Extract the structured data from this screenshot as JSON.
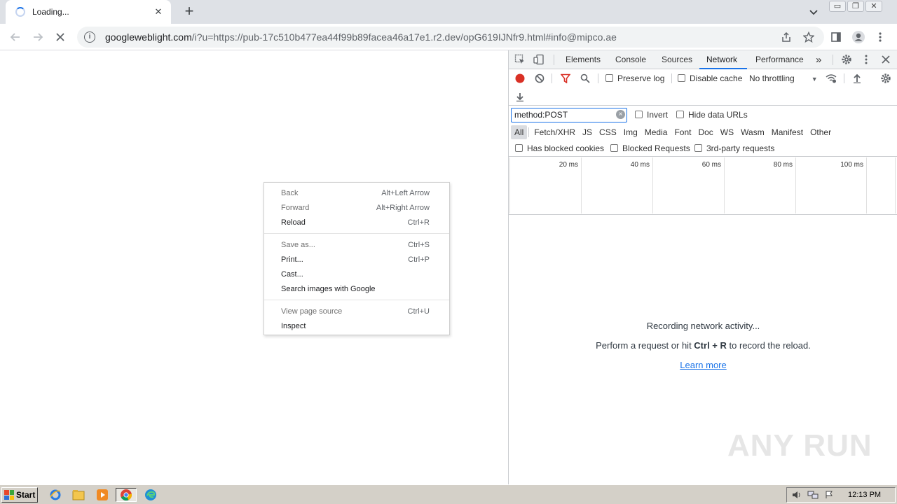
{
  "tab": {
    "title": "Loading...",
    "close": "✕"
  },
  "newtab": "+",
  "window_controls": {
    "minimize": "▭",
    "restore": "❐",
    "close": "✕"
  },
  "omnibox": {
    "host": "googleweblight.com",
    "rest": "/i?u=https://pub-17c510b477ea44f99b89facea46a17e1.r2.dev/opG619IJNfr9.html#info@mipco.ae"
  },
  "context_menu": {
    "items": [
      {
        "label": "Back",
        "shortcut": "Alt+Left Arrow",
        "disabled": true
      },
      {
        "label": "Forward",
        "shortcut": "Alt+Right Arrow",
        "disabled": true
      },
      {
        "label": "Reload",
        "shortcut": "Ctrl+R",
        "disabled": false
      },
      {
        "label": "Save as...",
        "shortcut": "Ctrl+S",
        "disabled": true
      },
      {
        "label": "Print...",
        "shortcut": "Ctrl+P",
        "disabled": false
      },
      {
        "label": "Cast...",
        "shortcut": "",
        "disabled": false
      },
      {
        "label": "Search images with Google",
        "shortcut": "",
        "disabled": false
      },
      {
        "label": "View page source",
        "shortcut": "Ctrl+U",
        "disabled": true
      },
      {
        "label": "Inspect",
        "shortcut": "",
        "disabled": false
      }
    ]
  },
  "devtools": {
    "tabs": [
      "Elements",
      "Console",
      "Sources",
      "Network",
      "Performance"
    ],
    "active_tab": "Network",
    "more_tabs": "»",
    "toolbar": {
      "preserve_log": "Preserve log",
      "disable_cache": "Disable cache",
      "throttling": "No throttling",
      "dropdown": "▼"
    },
    "filter": {
      "value": "method:POST",
      "invert": "Invert",
      "hide_data_urls": "Hide data URLs",
      "types": [
        "All",
        "Fetch/XHR",
        "JS",
        "CSS",
        "Img",
        "Media",
        "Font",
        "Doc",
        "WS",
        "Wasm",
        "Manifest",
        "Other"
      ],
      "active_type": "All",
      "has_blocked_cookies": "Has blocked cookies",
      "blocked_requests": "Blocked Requests",
      "third_party": "3rd-party requests"
    },
    "timeline_ticks": [
      "20 ms",
      "40 ms",
      "60 ms",
      "80 ms",
      "100 ms"
    ],
    "empty": {
      "line1": "Recording network activity...",
      "line2_pre": "Perform a request or hit ",
      "line2_key": "Ctrl + R",
      "line2_post": " to record the reload.",
      "link": "Learn more"
    },
    "accent": "#1a73e8",
    "record_color": "#d93025"
  },
  "watermark": "ANY RUN",
  "taskbar": {
    "start": "Start",
    "apps": [
      "ie-icon",
      "explorer-icon",
      "media-player-icon",
      "chrome-icon",
      "edge-icon"
    ],
    "clock": "12:13 PM"
  }
}
